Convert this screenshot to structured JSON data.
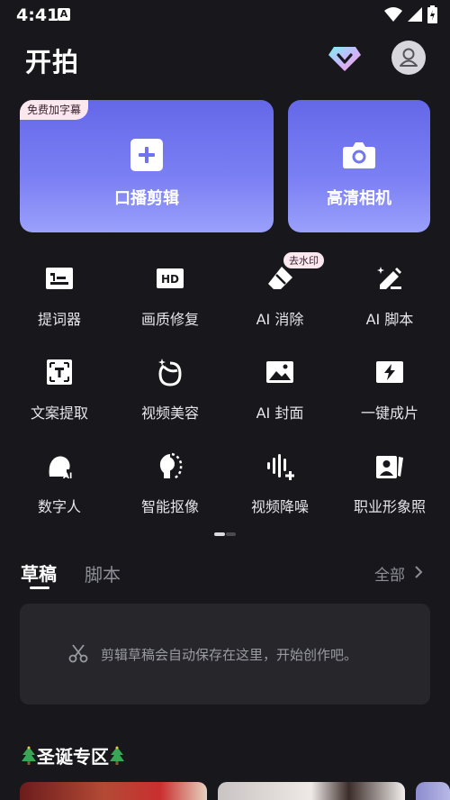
{
  "status_bar": {
    "time": "4:41",
    "notification_glyph": "A"
  },
  "header": {
    "title": "开拍",
    "vip_icon": "diamond-icon",
    "avatar_icon": "user-icon"
  },
  "cards": [
    {
      "label": "口播剪辑",
      "badge": "免费加字幕",
      "icon": "plus-icon"
    },
    {
      "label": "高清相机",
      "icon": "camera-icon"
    }
  ],
  "tools": [
    {
      "label": "提词器",
      "icon": "teleprompter-icon"
    },
    {
      "label": "画质修复",
      "icon": "hd-icon"
    },
    {
      "label": "AI 消除",
      "icon": "eraser-icon",
      "badge": "去水印"
    },
    {
      "label": "AI 脚本",
      "icon": "magic-pen-icon"
    },
    {
      "label": "文案提取",
      "icon": "text-extract-icon"
    },
    {
      "label": "视频美容",
      "icon": "beauty-icon"
    },
    {
      "label": "AI 封面",
      "icon": "image-icon"
    },
    {
      "label": "一键成片",
      "icon": "lightning-icon"
    },
    {
      "label": "数字人",
      "icon": "digital-human-icon"
    },
    {
      "label": "智能抠像",
      "icon": "cutout-icon"
    },
    {
      "label": "视频降噪",
      "icon": "denoise-icon"
    },
    {
      "label": "职业形象照",
      "icon": "portrait-card-icon"
    }
  ],
  "drafts": {
    "tabs": [
      "草稿",
      "脚本"
    ],
    "active_tab": 0,
    "all_label": "全部",
    "empty_text": "剪辑草稿会自动保存在这里，开始创作吧。"
  },
  "xmas": {
    "title": "圣诞专区"
  },
  "colors": {
    "background": "#18181c",
    "card_gradient_top": "#6468e8",
    "card_gradient_bottom": "#9aa0fb",
    "badge_bg": "#fbe7ee",
    "panel": "#26262b"
  }
}
